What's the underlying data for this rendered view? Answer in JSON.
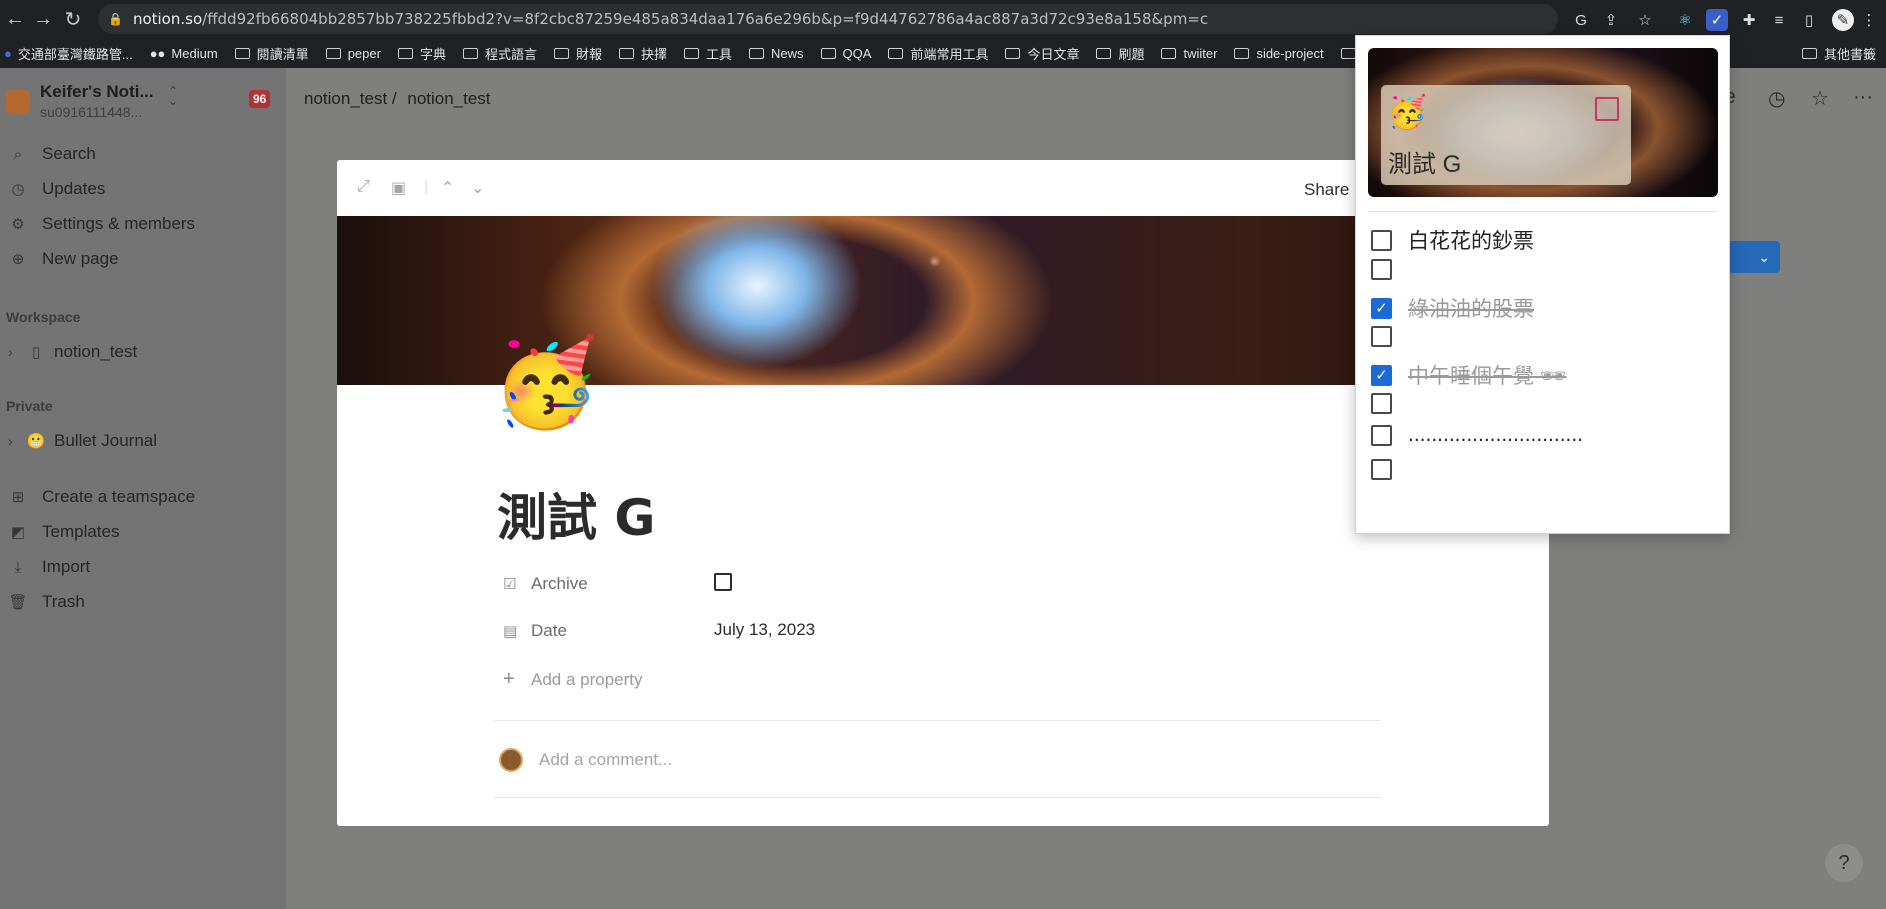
{
  "browser": {
    "url_domain": "notion.so",
    "url_rest": "/ffdd92fb66804bb2857bb738225fbbd2?v=8f2cbc87259e485a834daa176a6e296b&p=f9d44762786a4ac887a3d72c93e8a158&pm=c",
    "bookmarks": [
      "交通部臺灣鐵路管...",
      "Medium",
      "閱讀清單",
      "peper",
      "字典",
      "程式語言",
      "財報",
      "抉擇",
      "工具",
      "News",
      "QQA",
      "前端常用工具",
      "今日文章",
      "刷題",
      "twiiter",
      "side-project",
      "g"
    ],
    "bookmarks_right": "其他書籤"
  },
  "sidebar": {
    "workspace_name": "Keifer's Noti...",
    "workspace_email": "su0916111448...",
    "badge": "96",
    "items": [
      "Search",
      "Updates",
      "Settings & members",
      "New page"
    ],
    "workspace_label": "Workspace",
    "workspace_page": "notion_test",
    "private_label": "Private",
    "private_page": "Bullet Journal",
    "bottom_items": [
      "Create a teamspace",
      "Templates",
      "Import",
      "Trash"
    ]
  },
  "breadcrumb": [
    "notion_test /",
    "notion_test"
  ],
  "top_right_text": "re",
  "modal": {
    "share_label": "Share",
    "emoji": "🥳",
    "title": "測試 G",
    "properties": [
      {
        "name": "Archive",
        "value": ""
      },
      {
        "name": "Date",
        "value": "July 13, 2023"
      }
    ],
    "add_property": "Add a property",
    "comment_placeholder": "Add a comment..."
  },
  "popup": {
    "emoji": "🥳",
    "title": "測試 G",
    "todos": [
      {
        "text": "白花花的鈔票",
        "checked": false
      },
      {
        "text": "",
        "checked": false
      },
      {
        "text": "綠油油的股票",
        "checked": true
      },
      {
        "text": "",
        "checked": false
      },
      {
        "text": "中午睡個午覺 🕶",
        "checked": true
      },
      {
        "text": "",
        "checked": false
      },
      {
        "text": "..............................",
        "checked": false
      },
      {
        "text": "",
        "checked": false
      }
    ]
  },
  "help_label": "?"
}
